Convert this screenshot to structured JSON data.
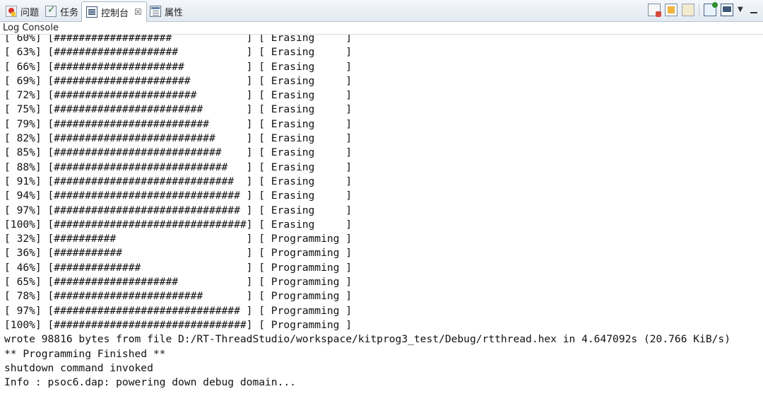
{
  "tabs": [
    {
      "label": "问题",
      "icon": "problems-icon"
    },
    {
      "label": "任务",
      "icon": "tasks-icon"
    },
    {
      "label": "控制台",
      "icon": "console-icon",
      "active": true,
      "close": "☒"
    },
    {
      "label": "属性",
      "icon": "properties-icon"
    }
  ],
  "toolbar_icons": [
    "clear-console-icon",
    "scroll-lock-icon",
    "pin-console-icon",
    "display-console-icon",
    "open-console-icon",
    "view-menu-icon"
  ],
  "console_title": "Log Console",
  "console_lines": [
    "[ 60%] [###################            ] [ Erasing     ]",
    "[ 63%] [####################           ] [ Erasing     ]",
    "[ 66%] [#####################          ] [ Erasing     ]",
    "[ 69%] [######################         ] [ Erasing     ]",
    "[ 72%] [#######################        ] [ Erasing     ]",
    "[ 75%] [########################       ] [ Erasing     ]",
    "[ 79%] [#########################      ] [ Erasing     ]",
    "[ 82%] [##########################     ] [ Erasing     ]",
    "[ 85%] [###########################    ] [ Erasing     ]",
    "[ 88%] [############################   ] [ Erasing     ]",
    "[ 91%] [#############################  ] [ Erasing     ]",
    "[ 94%] [############################## ] [ Erasing     ]",
    "[ 97%] [############################## ] [ Erasing     ]",
    "[100%] [###############################] [ Erasing     ]",
    "[ 32%] [##########                     ] [ Programming ]",
    "[ 36%] [###########                    ] [ Programming ]",
    "[ 46%] [##############                 ] [ Programming ]",
    "[ 65%] [####################           ] [ Programming ]",
    "[ 78%] [########################       ] [ Programming ]",
    "[ 97%] [############################## ] [ Programming ]",
    "[100%] [###############################] [ Programming ]",
    "wrote 98816 bytes from file D:/RT-ThreadStudio/workspace/kitprog3_test/Debug/rtthread.hex in 4.647092s (20.766 KiB/s)",
    "** Programming Finished **",
    "shutdown command invoked",
    "Info : psoc6.dap: powering down debug domain..."
  ]
}
